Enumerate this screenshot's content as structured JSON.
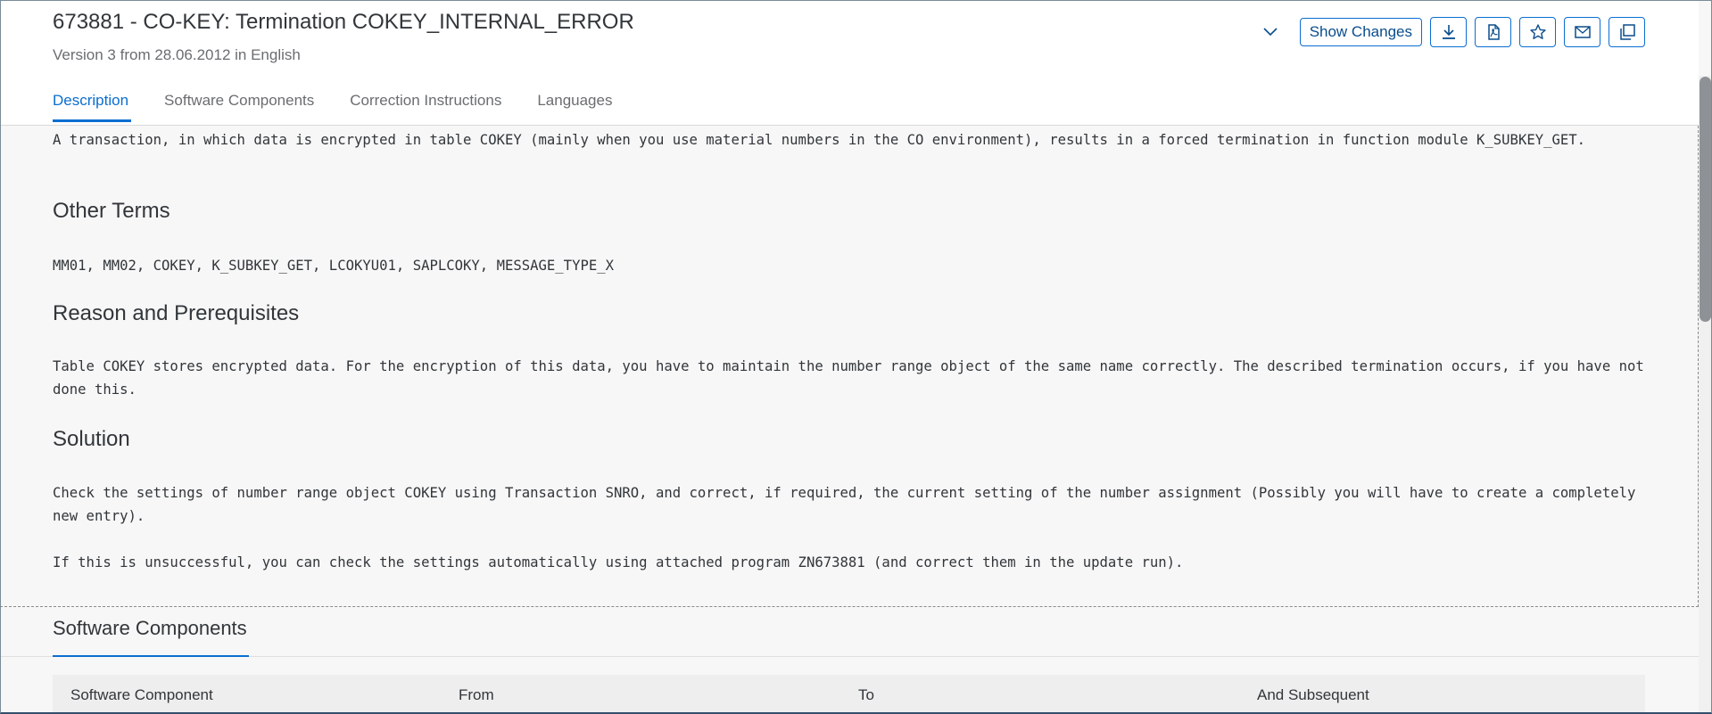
{
  "note": {
    "title": "673881 - CO-KEY: Termination COKEY_INTERNAL_ERROR",
    "subtitle": "Version 3 from 28.06.2012 in English"
  },
  "toolbar": {
    "expand_icon": "chevron-down-icon",
    "show_changes_label": "Show Changes",
    "icons": [
      "download-icon",
      "pdf-icon",
      "star-icon",
      "mail-icon",
      "copy-icon"
    ]
  },
  "tabs": [
    {
      "label": "Description",
      "active": true
    },
    {
      "label": "Software Components",
      "active": false
    },
    {
      "label": "Correction Instructions",
      "active": false
    },
    {
      "label": "Languages",
      "active": false
    }
  ],
  "description": {
    "symptom_text": "A transaction, in which data is encrypted in table COKEY (mainly when you use material numbers in the CO environment), results in a forced termination in function module K_SUBKEY_GET.",
    "other_terms_heading": "Other Terms",
    "other_terms_text": "MM01, MM02, COKEY, K_SUBKEY_GET, LCOKYU01, SAPLCOKY, MESSAGE_TYPE_X",
    "reason_heading": "Reason and Prerequisites",
    "reason_text": "Table COKEY stores encrypted data. For the encryption of this data, you have to maintain the number range object of the same name correctly. The described termination occurs, if you have not done this.",
    "solution_heading": "Solution",
    "solution_text_1": "Check the settings of number range object COKEY using Transaction SNRO, and correct, if required, the current setting of the number assignment (Possibly you will have to create a completely new entry).",
    "solution_text_2": "If this is unsuccessful, you can check the settings automatically using attached program ZN673881 (and correct them in the update run)."
  },
  "software_components": {
    "title": "Software Components",
    "columns": [
      "Software Component",
      "From",
      "To",
      "And Subsequent"
    ]
  },
  "colors": {
    "accent": "#0a6ed1",
    "background": "#f7f7f7",
    "header_bg": "#ffffff",
    "text": "#32363a",
    "muted_text": "#6a6d70"
  }
}
